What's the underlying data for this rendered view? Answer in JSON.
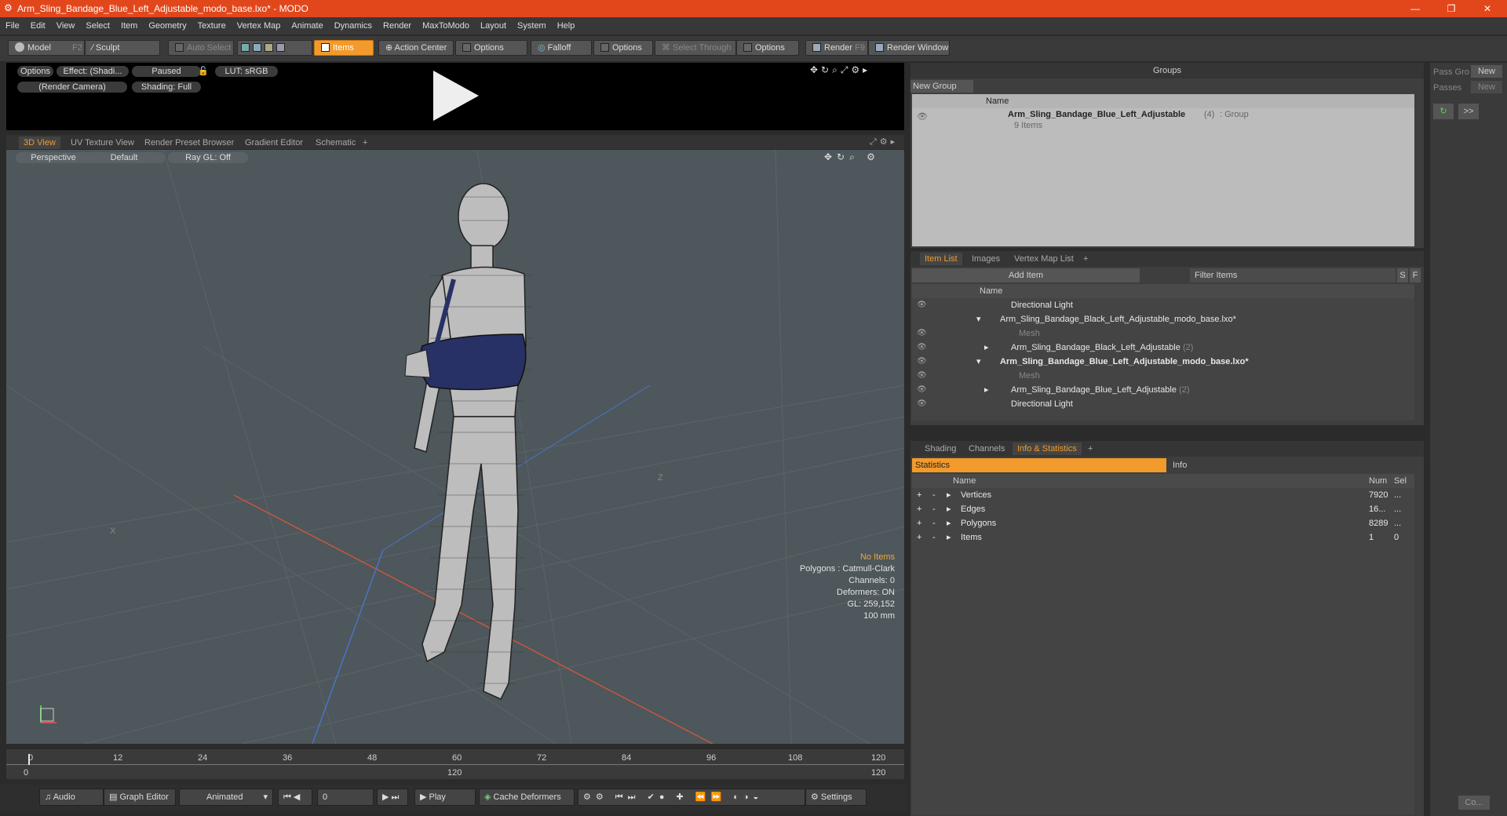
{
  "window": {
    "title": "Arm_Sling_Bandage_Blue_Left_Adjustable_modo_base.lxo* - MODO"
  },
  "menu": [
    "File",
    "Edit",
    "View",
    "Select",
    "Item",
    "Geometry",
    "Texture",
    "Vertex Map",
    "Animate",
    "Dynamics",
    "Render",
    "MaxToModo",
    "Layout",
    "System",
    "Help"
  ],
  "toolbar": {
    "model": "Model",
    "model_key": "F2",
    "sculpt": "Sculpt",
    "auto_select": "Auto Select",
    "items": "Items",
    "action_center": "Action Center",
    "options1": "Options",
    "falloff": "Falloff",
    "options2": "Options",
    "select_through": "Select Through",
    "options3": "Options",
    "render": "Render",
    "render_key": "F9",
    "render_window": "Render Window"
  },
  "preview": {
    "options": "Options",
    "effect": "Effect: (Shadi...",
    "paused": "Paused",
    "lut": "LUT: sRGB",
    "camera": "(Render Camera)",
    "shading": "Shading: Full"
  },
  "viewtabs": [
    "3D View",
    "UV Texture View",
    "Render Preset Browser",
    "Gradient Editor",
    "Schematic",
    "+"
  ],
  "viewport": {
    "perspective": "Perspective",
    "default": "Default",
    "raygl": "Ray GL: Off",
    "hud": [
      "No Items",
      "Polygons : Catmull-Clark",
      "Channels: 0",
      "Deformers: ON",
      "GL: 259,152",
      "100 mm"
    ],
    "axis_x": "X",
    "axis_z": "Z"
  },
  "timeline": {
    "ticks": [
      "0",
      "12",
      "24",
      "36",
      "48",
      "60",
      "72",
      "84",
      "96",
      "108",
      "120"
    ],
    "sub_left": "0",
    "sub_mid": "120",
    "sub_right": "120"
  },
  "bottom": {
    "audio": "Audio",
    "graph_editor": "Graph Editor",
    "animated": "Animated",
    "frame": "0",
    "play": "Play",
    "cache": "Cache Deformers",
    "settings": "Settings"
  },
  "groups": {
    "title": "Groups",
    "new_group": "New Group",
    "col_name": "Name",
    "row_name": "Arm_Sling_Bandage_Blue_Left_Adjustable",
    "row_count": "(4)",
    "row_type": ": Group",
    "row_sub": "9 Items"
  },
  "farright": {
    "pass_group": "Pass Gro",
    "passes": "Passes",
    "new1": "New",
    "new2": "New",
    "more": ">>",
    "co": "Co..."
  },
  "itemlist": {
    "tabs": [
      "Item List",
      "Images",
      "Vertex Map List",
      "+"
    ],
    "add_item": "Add Item",
    "filter": "Filter Items",
    "s": "S",
    "f": "F",
    "col_name": "Name",
    "rows": [
      {
        "label": "Directional Light",
        "style": "normal",
        "indent": 100
      },
      {
        "label": "Arm_Sling_Bandage_Black_Left_Adjustable_modo_base.lxo*",
        "style": "normal",
        "indent": 90
      },
      {
        "label": "Mesh",
        "style": "grey",
        "indent": 110
      },
      {
        "label": "Arm_Sling_Bandage_Black_Left_Adjustable",
        "count": "(2)",
        "style": "normal",
        "indent": 100
      },
      {
        "label": "Arm_Sling_Bandage_Blue_Left_Adjustable_modo_base.lxo*",
        "style": "bold",
        "indent": 90
      },
      {
        "label": "Mesh",
        "style": "grey",
        "indent": 110
      },
      {
        "label": "Arm_Sling_Bandage_Blue_Left_Adjustable",
        "count": "(2)",
        "style": "normal",
        "indent": 100
      },
      {
        "label": "Directional Light",
        "style": "normal",
        "indent": 100
      }
    ]
  },
  "stats": {
    "tabs": [
      "Shading",
      "Channels",
      "Info & Statistics",
      "+"
    ],
    "statistics": "Statistics",
    "info": "Info",
    "col_name": "Name",
    "col_num": "Num",
    "col_sel": "Sel",
    "rows": [
      {
        "name": "Vertices",
        "num": "7920",
        "sel": "..."
      },
      {
        "name": "Edges",
        "num": "16...",
        "sel": "..."
      },
      {
        "name": "Polygons",
        "num": "8289",
        "sel": "..."
      },
      {
        "name": "Items",
        "num": "1",
        "sel": "0"
      }
    ]
  }
}
